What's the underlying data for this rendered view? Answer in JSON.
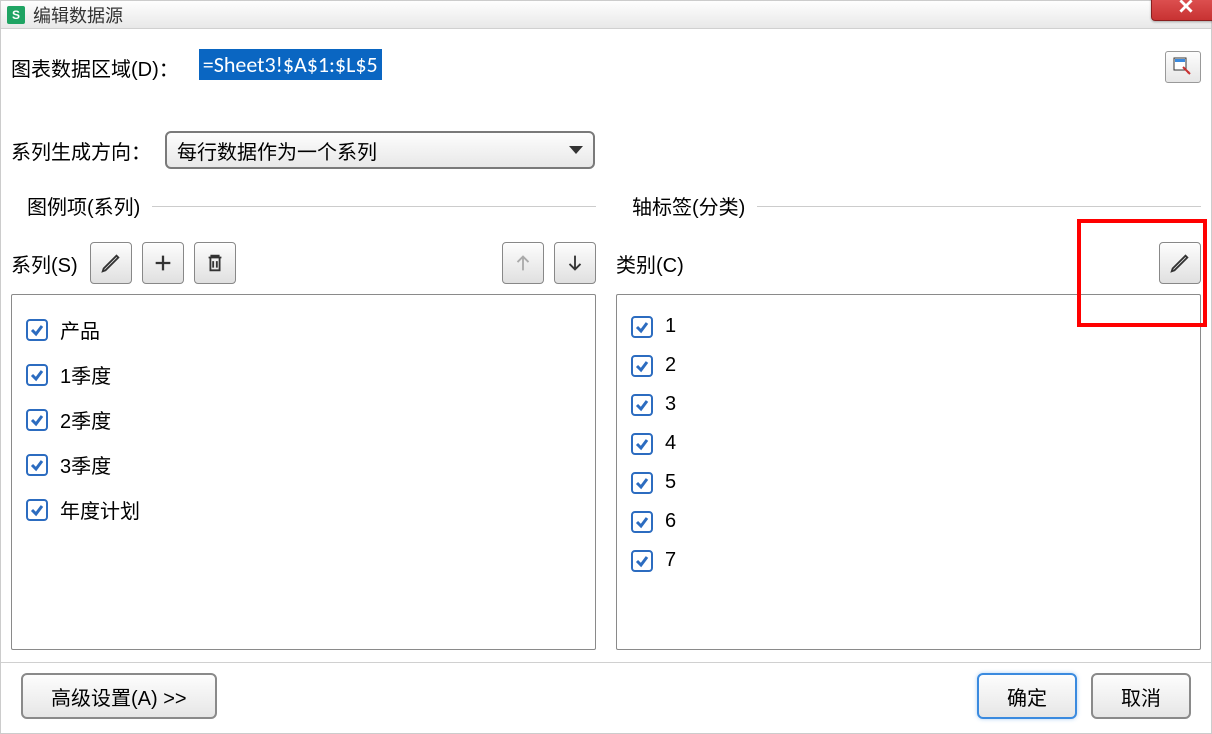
{
  "title": "编辑数据源",
  "chart_range": {
    "label": "图表数据区域(D)：",
    "value": "=Sheet3!$A$1:$L$5"
  },
  "series_direction": {
    "label": "系列生成方向：",
    "selected": "每行数据作为一个系列"
  },
  "legend_section": {
    "title": "图例项(系列)",
    "series_label": "系列(S)",
    "items": [
      {
        "label": "产品",
        "checked": true
      },
      {
        "label": "1季度",
        "checked": true
      },
      {
        "label": "2季度",
        "checked": true
      },
      {
        "label": "3季度",
        "checked": true
      },
      {
        "label": "年度计划",
        "checked": true
      }
    ]
  },
  "axis_section": {
    "title": "轴标签(分类)",
    "category_label": "类别(C)",
    "items": [
      {
        "label": "1",
        "checked": true
      },
      {
        "label": "2",
        "checked": true
      },
      {
        "label": "3",
        "checked": true
      },
      {
        "label": "4",
        "checked": true
      },
      {
        "label": "5",
        "checked": true
      },
      {
        "label": "6",
        "checked": true
      },
      {
        "label": "7",
        "checked": true
      }
    ]
  },
  "footer": {
    "advanced": "高级设置(A) >>",
    "ok": "确定",
    "cancel": "取消"
  }
}
